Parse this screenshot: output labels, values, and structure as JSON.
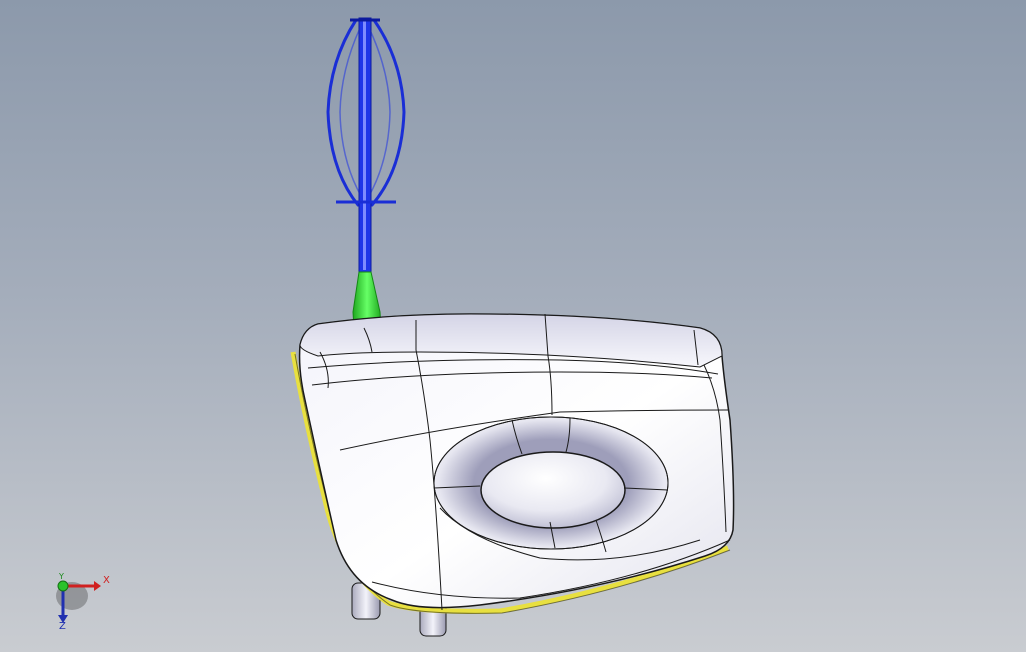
{
  "viewport": {
    "background_top": "#8c99ab",
    "background_bottom": "#c9ccd1"
  },
  "model": {
    "body_fill": "#ffffff",
    "body_shade": "#bfbfd6",
    "edge_color": "#1a1a1a",
    "seam_color": "#e8e040",
    "selected_handle_color": "#1a2ed6",
    "selected_grip_color": "#33dd33"
  },
  "triad": {
    "x_label": "X",
    "y_label": "Y",
    "z_label": "Z",
    "x_color": "#d02020",
    "y_color": "#1a8a1a",
    "z_color": "#2030b0"
  }
}
